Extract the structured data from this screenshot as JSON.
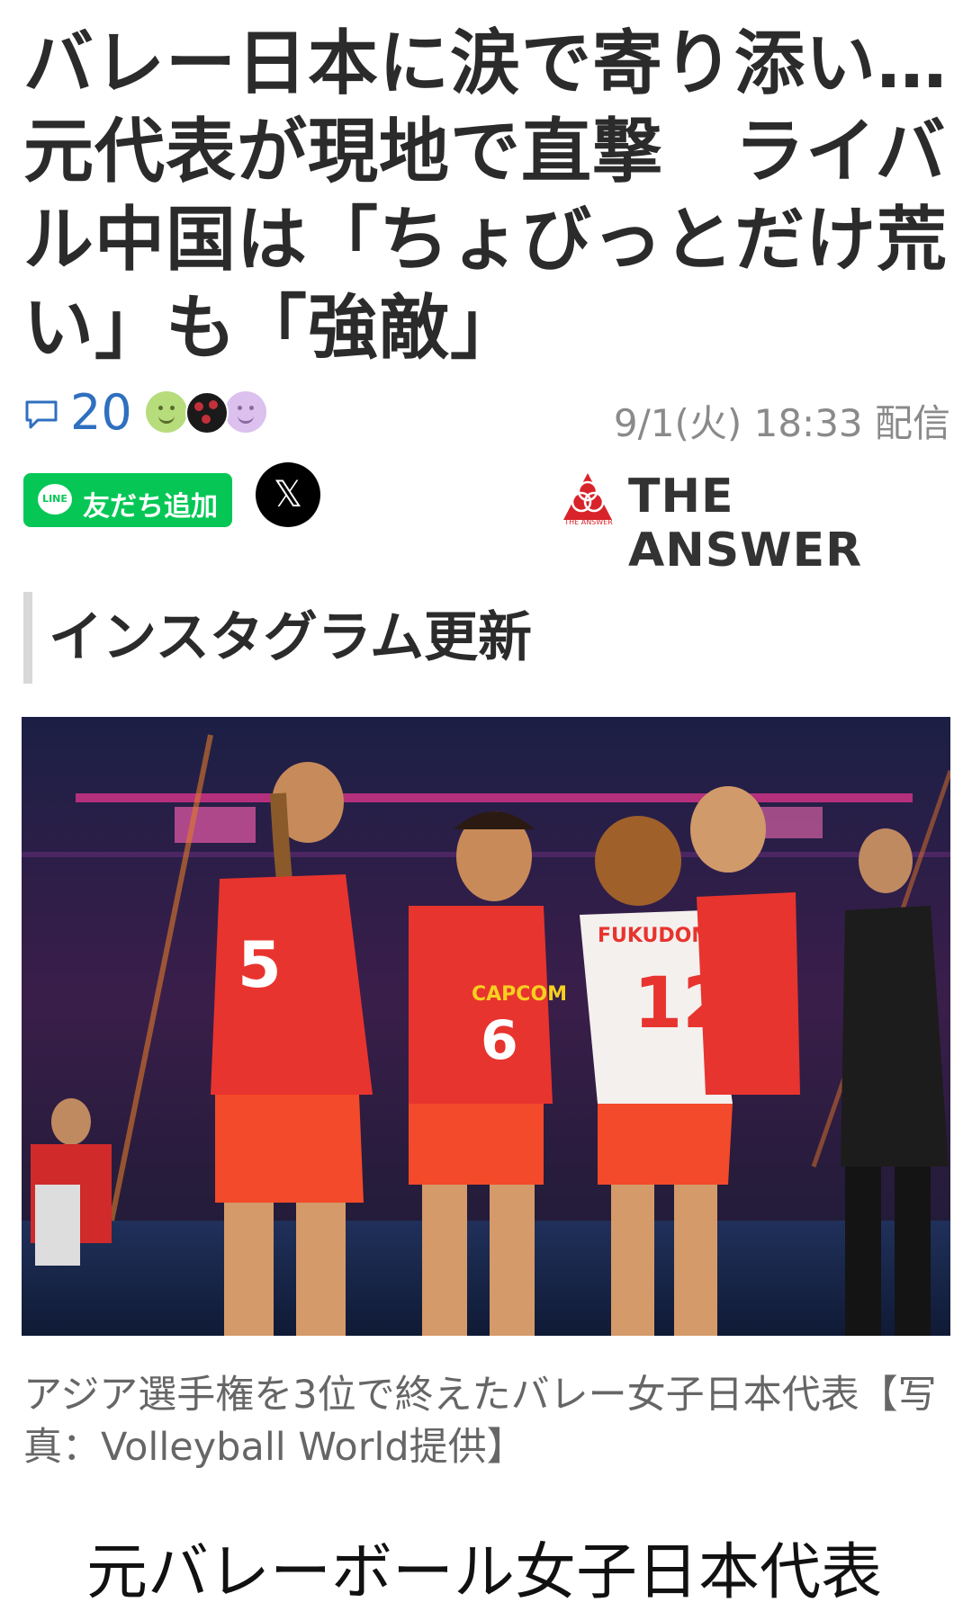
{
  "article": {
    "headline": "バレー日本に涙で寄り添い…元代表が現地で直撃　ライバル中国は「ちょびっとだけ荒い」も「強敵」",
    "comment_count": "20",
    "timestamp": "9/1(火) 18:33 配信"
  },
  "share": {
    "line_badge": "LINE",
    "line_label": "友だち追加",
    "x_icon": "𝕏"
  },
  "publisher": {
    "name": "THE ANSWER",
    "mark_caption": "THE ANSWER",
    "brand_color": "#d8232a"
  },
  "section": {
    "heading": "インスタグラム更新"
  },
  "photo": {
    "jersey_numbers": [
      "5",
      "6",
      "12"
    ],
    "jersey_name": "FUKUDOME",
    "sponsor": "CAPCOM"
  },
  "caption": "アジア選手権を3位で終えたバレー女子日本代表【写真：Volleyball World提供】",
  "body_start": "元バレーボール女子日本代表",
  "colors": {
    "comment_blue": "#2f6fbf",
    "line_green": "#06c755",
    "jersey_red": "#e8342e"
  }
}
